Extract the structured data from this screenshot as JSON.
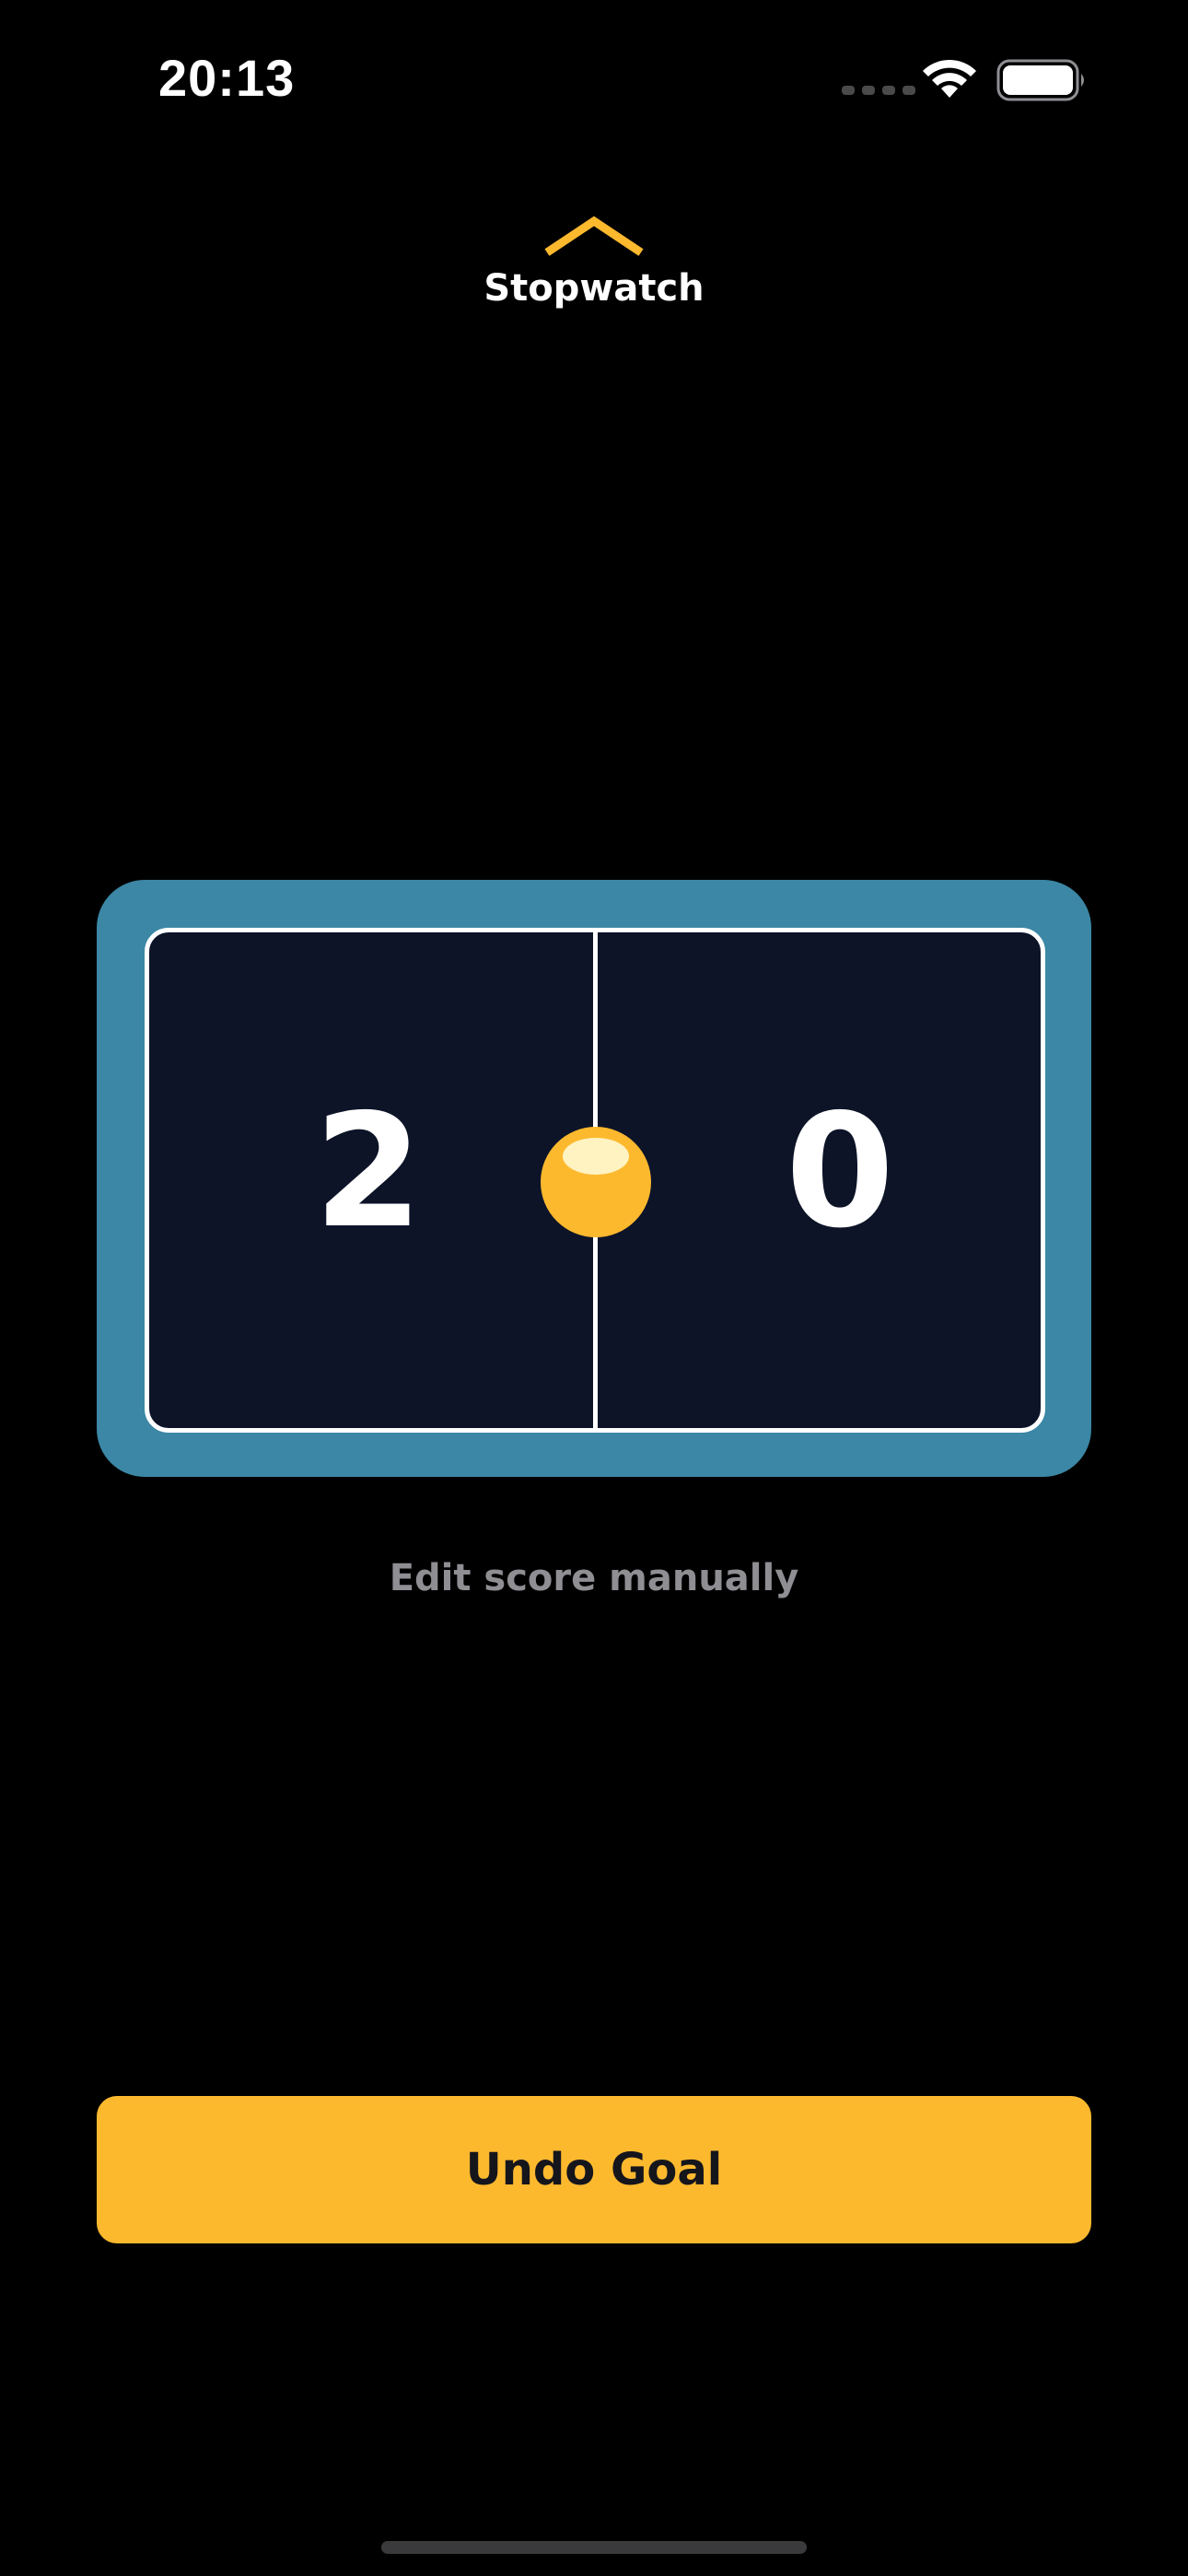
{
  "status_bar": {
    "time": "20:13"
  },
  "header": {
    "title": "Stopwatch",
    "chevron_icon": "chevron-up-icon"
  },
  "scoreboard": {
    "home_score": "2",
    "away_score": "0",
    "ball_icon": "ball-icon"
  },
  "edit_link": {
    "label": "Edit score manually"
  },
  "undo_button": {
    "label": "Undo Goal"
  },
  "colors": {
    "accent": "#fdb92e",
    "board_frame": "#3b87a5",
    "board_field": "#0d1428",
    "muted_text": "#8e8e93"
  }
}
